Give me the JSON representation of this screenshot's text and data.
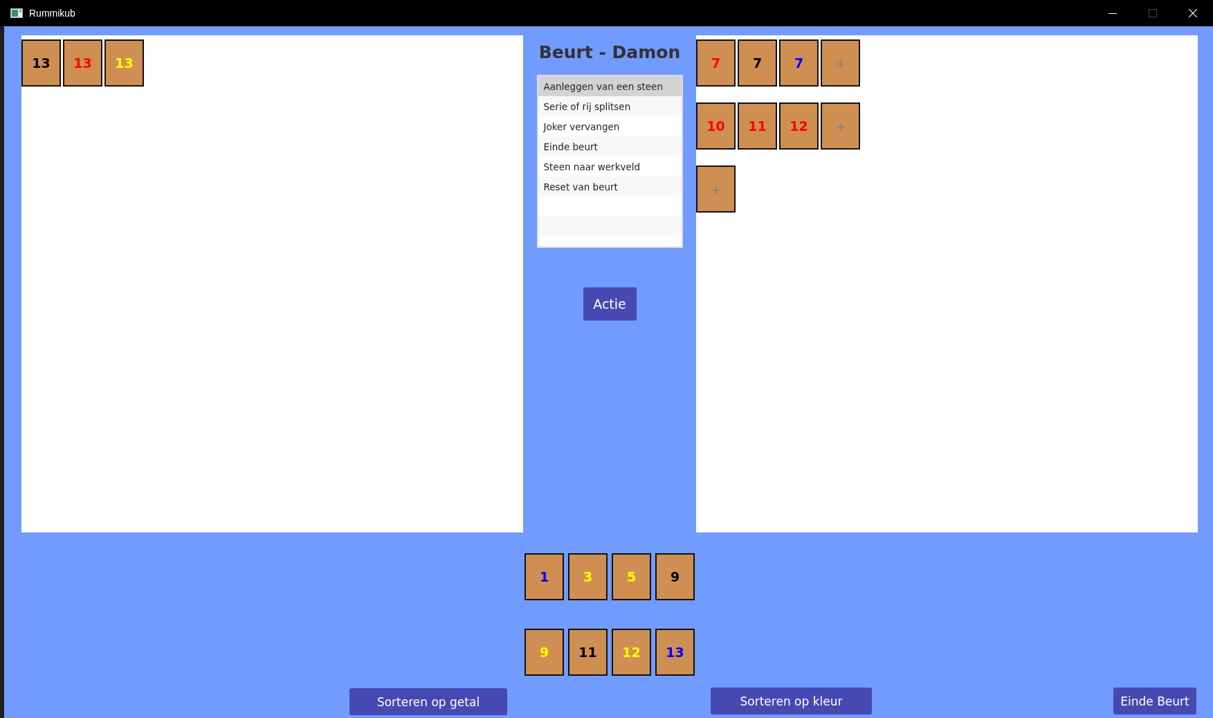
{
  "window": {
    "title": "Rummikub",
    "maximize_disabled": true
  },
  "table_left": {
    "sets": [
      [
        {
          "kind": "number",
          "label": "13",
          "color": "#000000"
        },
        {
          "kind": "number",
          "label": "13",
          "color": "#ff0000"
        },
        {
          "kind": "number",
          "label": "13",
          "color": "#ffff00"
        }
      ]
    ]
  },
  "turn_title": "Beurt - Damon",
  "actions": [
    {
      "label": "Aanleggen van een steen",
      "selected": true
    },
    {
      "label": "Serie of rij splitsen",
      "selected": false
    },
    {
      "label": "Joker vervangen",
      "selected": false
    },
    {
      "label": "Einde beurt",
      "selected": false
    },
    {
      "label": "Steen naar werkveld",
      "selected": false
    },
    {
      "label": "Reset van beurt",
      "selected": false
    }
  ],
  "action_button": "Actie",
  "table_right": {
    "sets": [
      [
        {
          "kind": "number",
          "label": "7",
          "color": "#ff0000"
        },
        {
          "kind": "number",
          "label": "7",
          "color": "#000000"
        },
        {
          "kind": "number",
          "label": "7",
          "color": "#0000ff"
        },
        {
          "kind": "add",
          "label": "+"
        }
      ],
      [
        {
          "kind": "number",
          "label": "10",
          "color": "#ff0000"
        },
        {
          "kind": "number",
          "label": "11",
          "color": "#ff0000"
        },
        {
          "kind": "number",
          "label": "12",
          "color": "#ff0000"
        },
        {
          "kind": "add",
          "label": "+"
        }
      ],
      [
        {
          "kind": "add",
          "label": "+"
        }
      ]
    ]
  },
  "hand": [
    [
      {
        "kind": "number",
        "label": "1",
        "color": "#0000ff"
      },
      {
        "kind": "number",
        "label": "3",
        "color": "#ffff00"
      },
      {
        "kind": "number",
        "label": "5",
        "color": "#ffff00"
      },
      {
        "kind": "number",
        "label": "9",
        "color": "#000000"
      }
    ],
    [
      {
        "kind": "number",
        "label": "9",
        "color": "#ffff00"
      },
      {
        "kind": "number",
        "label": "11",
        "color": "#000000"
      },
      {
        "kind": "number",
        "label": "12",
        "color": "#ffff00"
      },
      {
        "kind": "number",
        "label": "13",
        "color": "#0000ff"
      }
    ]
  ],
  "buttons": {
    "sort_number": "Sorteren op getal",
    "sort_color": "Sorteren op kleur",
    "end_turn": "Einde Beurt"
  }
}
